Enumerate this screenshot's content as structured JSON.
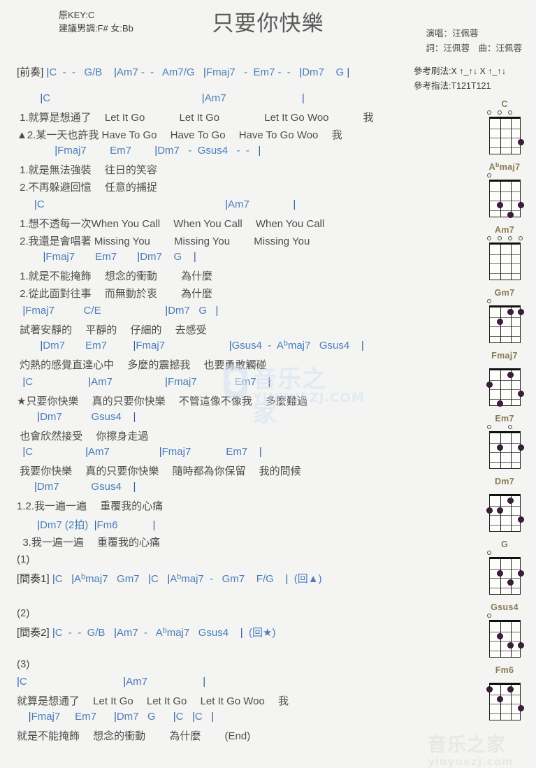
{
  "header": {
    "key_original": "原KEY:C",
    "key_suggested": "建議男調:F# 女:Bb",
    "title": "只要你快樂",
    "singer": "演唱：汪佩蓉",
    "writer": "詞：汪佩蓉　曲：汪佩蓉",
    "strum_pattern": "參考刷法:X ↑_↑↓ X ↑_↑↓",
    "finger_pattern": "參考指法:T121T121"
  },
  "colors": {
    "chord": "#4a7ebb",
    "lyric": "#4d4d4d",
    "chord_name": "#8a7a55",
    "background": "#f4f4f2",
    "watermark_blue": "#cfe2f5"
  },
  "intro": {
    "label": "[前奏]",
    "chords": "|C  -  -   G/B    |Am7 -  -   Am7/G   |Fmaj7   -  Em7 -  -   |Dm7    G |"
  },
  "sections": [
    {
      "id": "verse1-line1",
      "chords": "        |C                                                    |Am7                          |",
      "lyrics": [
        " 1.就算是想通了　 Let It Go　　　 Let It Go　　　　 Let It Go Woo　　　 我",
        "▲2.某一天也許我 Have To Go　 Have To Go　 Have To Go Woo　 我"
      ]
    },
    {
      "id": "verse1-line2",
      "chords": "             |Fmaj7        Em7        |Dm7   -  Gsus4   -  -   |",
      "lyrics": [
        " 1.就是無法強裝　 往日的笑容",
        " 2.不再躲避回憶　 任意的捕捉"
      ]
    },
    {
      "id": "verse2-line1",
      "chords": "      |C                                                              |Am7               |",
      "lyrics": [
        " 1.想不透每一次When You Call　 When You Call　 When You Call",
        " 2.我還是會唱著 Missing You　　 Missing You　　 Missing You"
      ]
    },
    {
      "id": "verse2-line2",
      "chords": "         |Fmaj7       Em7       |Dm7    G    |",
      "lyrics": [
        " 1.就是不能掩飾　 想念的衝動　　 為什麼",
        " 2.從此面對往事　 而無動於衷　　 為什麼"
      ]
    },
    {
      "id": "pre-chorus-1",
      "chords": "  |Fmaj7          C/E                      |Dm7   G   |",
      "lyrics": [
        " 試著安靜的　 平靜的　 仔細的　 去感受"
      ]
    },
    {
      "id": "pre-chorus-2",
      "chords": "        |Dm7       Em7         |Fmaj7                      |Gsus4  -  Abmaj7   Gsus4    |",
      "lyrics": [
        " 灼熱的感覺直達心中　 多麼的震撼我　 也要勇敢觸碰"
      ]
    },
    {
      "id": "chorus-1",
      "chords": "  |C                   |Am7                  |Fmaj7             Em7    |",
      "lyrics": [
        "★只要你快樂　 真的只要你快樂　 不管這像不像我　 多麼難過"
      ]
    },
    {
      "id": "chorus-2",
      "chords": "       |Dm7          Gsus4    |",
      "lyrics": [
        " 也會欣然接受　 你擦身走過"
      ]
    },
    {
      "id": "chorus-3",
      "chords": "  |C                  |Am7                 |Fmaj7            Em7    |",
      "lyrics": [
        " 我要你快樂　 真的只要你快樂　 隨時都為你保留　 我的問候"
      ]
    },
    {
      "id": "chorus-4",
      "chords": "      |Dm7           Gsus4    |",
      "lyrics": [
        "1.2.我一遍一遍　 重覆我的心痛"
      ]
    },
    {
      "id": "chorus-5",
      "chords": "       |Dm7 (2拍)  |Fm6            |",
      "lyrics": [
        "  3.我一遍一遍　 重覆我的心痛"
      ]
    }
  ],
  "endings": [
    {
      "marker": "(1)",
      "label": "[間奏1]",
      "chords": "|C   |Abmaj7   Gm7   |C   |Abmaj7  -   Gm7    F/G    |  (回▲)"
    },
    {
      "marker": "(2)",
      "label": "[間奏2]",
      "chords": "|C  -  -  G/B   |Am7  -   Abmaj7   Gsus4    |  (回★)"
    }
  ],
  "outro": {
    "marker": "(3)",
    "lines": [
      {
        "chords": "|C                                 |Am7                   |",
        "lyrics": [
          "就算是想通了　 Let It Go　 Let It Go　 Let It Go Woo　 我"
        ]
      },
      {
        "chords": "    |Fmaj7     Em7      |Dm7   G      |C   |C   |",
        "lyrics": [
          "就是不能掩飾　 想念的衝動　　 為什麼　　 (End)"
        ]
      }
    ]
  },
  "chord_diagrams": [
    {
      "name": "C",
      "name_html": "C",
      "strings": 4,
      "frets": 4,
      "open": [
        1,
        1,
        1,
        0
      ],
      "dots": [
        {
          "s": 4,
          "f": 3
        }
      ]
    },
    {
      "name": "Abmaj7",
      "name_html": "A<sup class=\"flat\">b</sup>maj7",
      "strings": 4,
      "frets": 4,
      "open": [
        1,
        0,
        0,
        0
      ],
      "dots": [
        {
          "s": 2,
          "f": 3
        },
        {
          "s": 4,
          "f": 3
        },
        {
          "s": 3,
          "f": 4
        }
      ]
    },
    {
      "name": "Am7",
      "name_html": "Am7",
      "strings": 4,
      "frets": 4,
      "open": [
        1,
        1,
        1,
        1
      ],
      "dots": []
    },
    {
      "name": "Gm7",
      "name_html": "Gm7",
      "strings": 4,
      "frets": 4,
      "open": [
        1,
        0,
        0,
        0
      ],
      "dots": [
        {
          "s": 3,
          "f": 1
        },
        {
          "s": 4,
          "f": 1
        },
        {
          "s": 2,
          "f": 2
        }
      ]
    },
    {
      "name": "Fmaj7",
      "name_html": "Fmaj7",
      "strings": 4,
      "frets": 4,
      "open": [
        0,
        0,
        0,
        0
      ],
      "dots": [
        {
          "s": 3,
          "f": 1
        },
        {
          "s": 1,
          "f": 2
        },
        {
          "s": 4,
          "f": 3
        },
        {
          "s": 2,
          "f": 4
        }
      ]
    },
    {
      "name": "Em7",
      "name_html": "Em7",
      "strings": 4,
      "frets": 4,
      "open": [
        1,
        0,
        1,
        0
      ],
      "dots": [
        {
          "s": 2,
          "f": 2
        },
        {
          "s": 4,
          "f": 2
        }
      ]
    },
    {
      "name": "Dm7",
      "name_html": "Dm7",
      "strings": 4,
      "frets": 4,
      "open": [
        0,
        0,
        0,
        0
      ],
      "dots": [
        {
          "s": 3,
          "f": 1
        },
        {
          "s": 1,
          "f": 2
        },
        {
          "s": 2,
          "f": 2
        },
        {
          "s": 4,
          "f": 3
        }
      ]
    },
    {
      "name": "G",
      "name_html": "G",
      "strings": 4,
      "frets": 4,
      "open": [
        1,
        0,
        0,
        0
      ],
      "dots": [
        {
          "s": 2,
          "f": 2
        },
        {
          "s": 4,
          "f": 2
        },
        {
          "s": 3,
          "f": 3
        }
      ]
    },
    {
      "name": "Gsus4",
      "name_html": "Gsus4",
      "strings": 4,
      "frets": 4,
      "open": [
        1,
        0,
        0,
        0
      ],
      "dots": [
        {
          "s": 2,
          "f": 2
        },
        {
          "s": 3,
          "f": 3
        },
        {
          "s": 4,
          "f": 3
        }
      ]
    },
    {
      "name": "Fm6",
      "name_html": "Fm6",
      "strings": 4,
      "frets": 4,
      "open": [
        0,
        0,
        0,
        0
      ],
      "dots": [
        {
          "s": 1,
          "f": 1
        },
        {
          "s": 3,
          "f": 1
        },
        {
          "s": 2,
          "f": 2
        },
        {
          "s": 4,
          "f": 3
        }
      ]
    }
  ],
  "watermarks": {
    "center_cn": "音乐之家",
    "center_url": "YINYUEZJ.COM",
    "bottom_cn": "音乐之家",
    "bottom_url": "yinyuezj.com"
  }
}
